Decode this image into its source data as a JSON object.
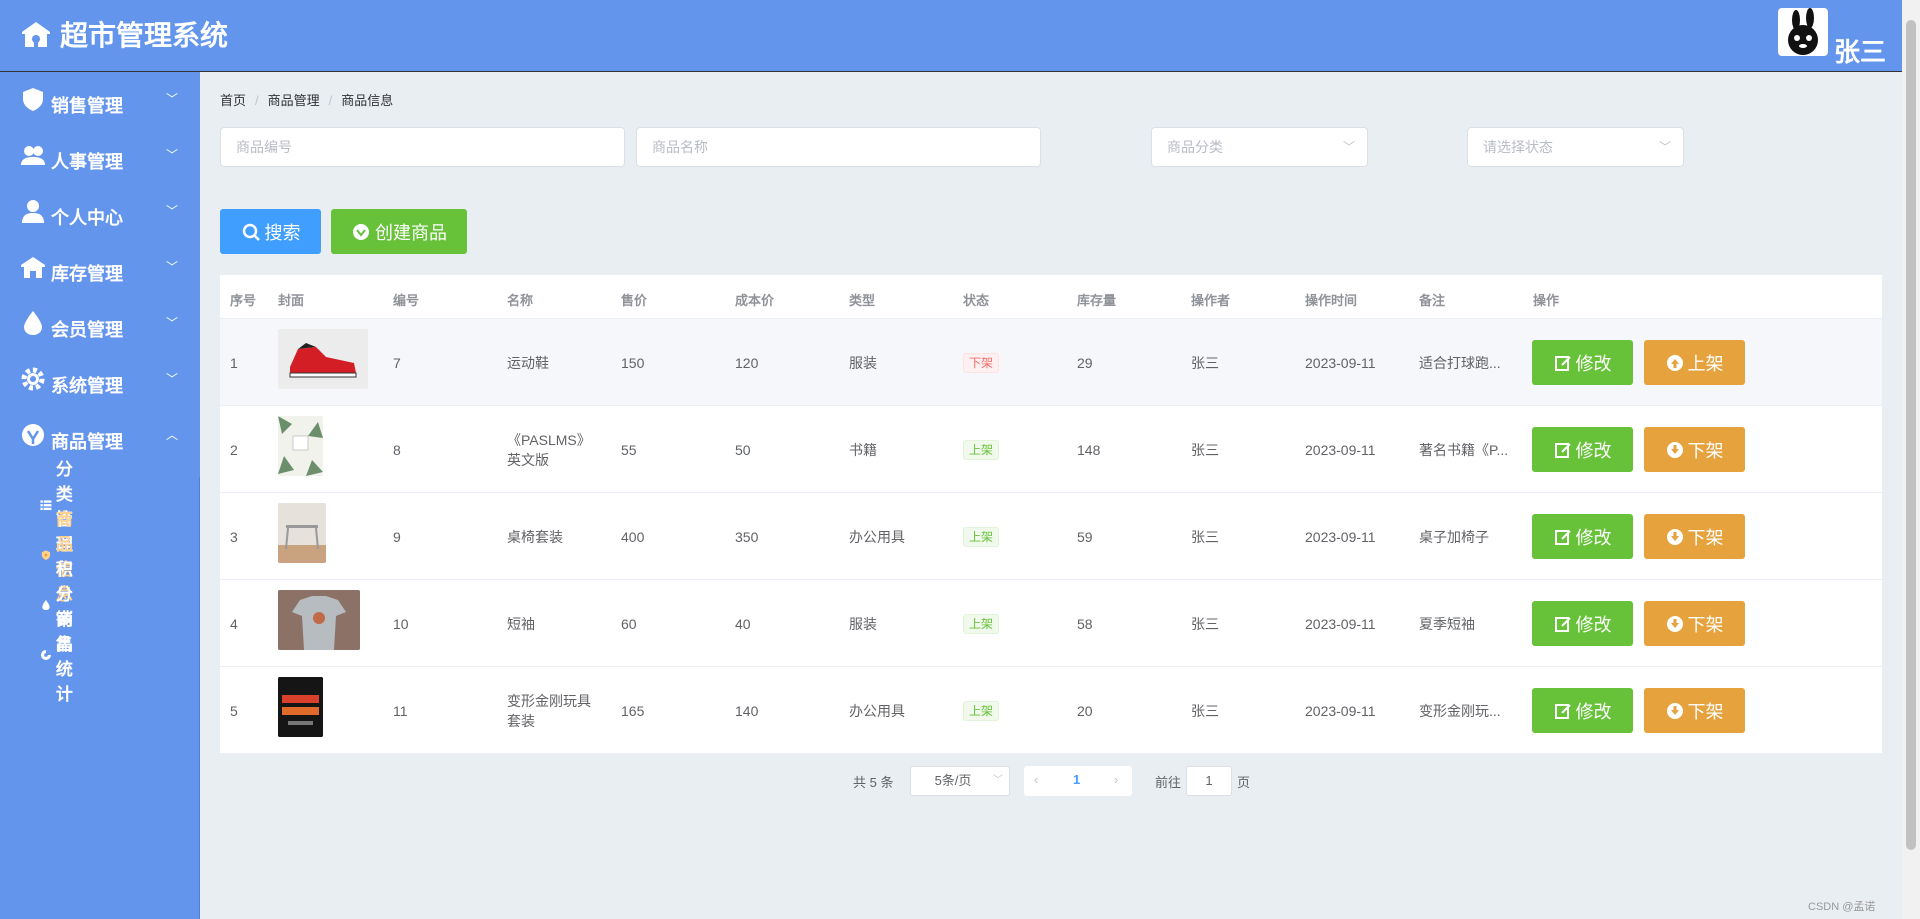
{
  "app": {
    "title": "超市管理系统",
    "user": "张三"
  },
  "sidebar": {
    "items": [
      {
        "label": "销售管理",
        "icon": "shield-icon"
      },
      {
        "label": "人事管理",
        "icon": "users-icon"
      },
      {
        "label": "个人中心",
        "icon": "user-icon"
      },
      {
        "label": "库存管理",
        "icon": "warehouse-icon"
      },
      {
        "label": "会员管理",
        "icon": "drop-icon"
      },
      {
        "label": "系统管理",
        "icon": "gear-icon"
      },
      {
        "label": "商品管理",
        "icon": "product-icon"
      }
    ],
    "subitems": [
      {
        "label": "分类管理",
        "icon": "list-icon"
      },
      {
        "label": "商品信息",
        "icon": "shield-icon"
      },
      {
        "label": "积分商品",
        "icon": "drop-icon"
      },
      {
        "label": "销售统计",
        "icon": "chart-icon"
      }
    ]
  },
  "breadcrumb": [
    "首页",
    "商品管理",
    "商品信息"
  ],
  "filters": {
    "code_placeholder": "商品编号",
    "name_placeholder": "商品名称",
    "category_placeholder": "商品分类",
    "status_placeholder": "请选择状态"
  },
  "toolbar": {
    "search_label": "搜索",
    "create_label": "创建商品"
  },
  "table": {
    "columns": [
      "序号",
      "封面",
      "编号",
      "名称",
      "售价",
      "成本价",
      "类型",
      "状态",
      "库存量",
      "操作者",
      "操作时间",
      "备注",
      "操作"
    ],
    "rows": [
      {
        "index": "1",
        "code": "7",
        "name": "运动鞋",
        "price": "150",
        "cost": "120",
        "type": "服装",
        "status": "下架",
        "stock": "29",
        "operator": "张三",
        "time": "2023-09-11",
        "note": "适合打球跑...",
        "edit": "修改",
        "toggle": "上架"
      },
      {
        "index": "2",
        "code": "8",
        "name": "《PASLMS》英文版",
        "price": "55",
        "cost": "50",
        "type": "书籍",
        "status": "上架",
        "stock": "148",
        "operator": "张三",
        "time": "2023-09-11",
        "note": "著名书籍《P...",
        "edit": "修改",
        "toggle": "下架"
      },
      {
        "index": "3",
        "code": "9",
        "name": "桌椅套装",
        "price": "400",
        "cost": "350",
        "type": "办公用具",
        "status": "上架",
        "stock": "59",
        "operator": "张三",
        "time": "2023-09-11",
        "note": "桌子加椅子",
        "edit": "修改",
        "toggle": "下架"
      },
      {
        "index": "4",
        "code": "10",
        "name": "短袖",
        "price": "60",
        "cost": "40",
        "type": "服装",
        "status": "上架",
        "stock": "58",
        "operator": "张三",
        "time": "2023-09-11",
        "note": "夏季短袖",
        "edit": "修改",
        "toggle": "下架"
      },
      {
        "index": "5",
        "code": "11",
        "name": "变形金刚玩具套装",
        "price": "165",
        "cost": "140",
        "type": "办公用具",
        "status": "上架",
        "stock": "20",
        "operator": "张三",
        "time": "2023-09-11",
        "note": "变形金刚玩...",
        "edit": "修改",
        "toggle": "下架"
      }
    ]
  },
  "pagination": {
    "total": "共 5 条",
    "page_size": "5条/页",
    "current": "1",
    "goto_label": "前往",
    "goto_value": "1",
    "page_unit": "页"
  },
  "watermark": "CSDN @孟诺"
}
